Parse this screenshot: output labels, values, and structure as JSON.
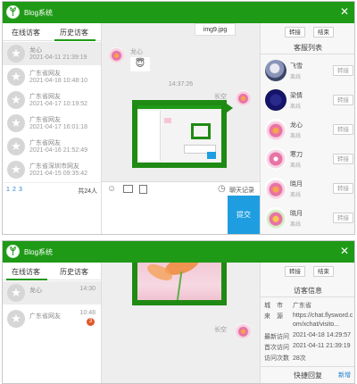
{
  "window1": {
    "title": "Blog系统",
    "tabs": [
      "在线访客",
      "历史访客"
    ],
    "visitors": [
      {
        "name": "龙心",
        "time": "2021-04-11 21:39:19",
        "selected": true
      },
      {
        "name": "广东省网友",
        "time": "2021-04-18 10:48:10"
      },
      {
        "name": "广东省网友",
        "time": "2021-04-17 10:19:52"
      },
      {
        "name": "广东省网友",
        "time": "2021-04-17 16:01:18"
      },
      {
        "name": "广东省网友",
        "time": "2021-04-16 21:52:49"
      },
      {
        "name": "广东省深圳市网友",
        "time": "2021-04-15 09:35:42"
      }
    ],
    "pagination": {
      "pages": [
        "1",
        "2",
        "3"
      ],
      "total": "共24人"
    },
    "chat": {
      "tab_label": "img9.jpg",
      "msg1_name": "龙心",
      "msg1_emoji": "😇",
      "timestamp": "14:37:26",
      "msg2_name": "长空",
      "history_link": "聊天记录",
      "send_label": "提交"
    },
    "toolbar": {
      "transfer": "转接",
      "end": "结束"
    },
    "service_title": "客服列表",
    "services": [
      {
        "name": "飞雪",
        "status": "离线",
        "btn": "转接"
      },
      {
        "name": "梁情",
        "status": "离线",
        "btn": "转接"
      },
      {
        "name": "龙心",
        "status": "离线",
        "btn": "转接"
      },
      {
        "name": "寒刀",
        "status": "离线",
        "btn": "转接"
      },
      {
        "name": "晓月",
        "status": "离线",
        "btn": "转接"
      },
      {
        "name": "晓月",
        "status": "离线",
        "btn": "转接"
      }
    ]
  },
  "window2": {
    "title": "Blog系统",
    "tabs": [
      "在线访客",
      "历史访客"
    ],
    "visitors": [
      {
        "name": "龙心",
        "time": "14:30",
        "selected": true
      },
      {
        "name": "广东省网友",
        "time": "10:48",
        "badge": "3"
      }
    ],
    "chat": {
      "msg_name": "长空"
    },
    "toolbar": {
      "transfer": "转接",
      "end": "结束"
    },
    "info_title": "访客信息",
    "info": [
      {
        "label": "城　市",
        "value": "广东省"
      },
      {
        "label": "来　源",
        "value": "https://chat.flysword.com/xchat/visito..."
      },
      {
        "label": "最新访问",
        "value": "2021-04-18 14:29:57"
      },
      {
        "label": "首次访问",
        "value": "2021-04-11 21:39:19"
      },
      {
        "label": "访问次数",
        "value": "28次"
      }
    ],
    "quick_reply": "快捷回复",
    "new_label": "新增"
  },
  "colors": {
    "brand": "#1f9a17",
    "send": "#1e9ee0",
    "badge": "#e0582a"
  }
}
